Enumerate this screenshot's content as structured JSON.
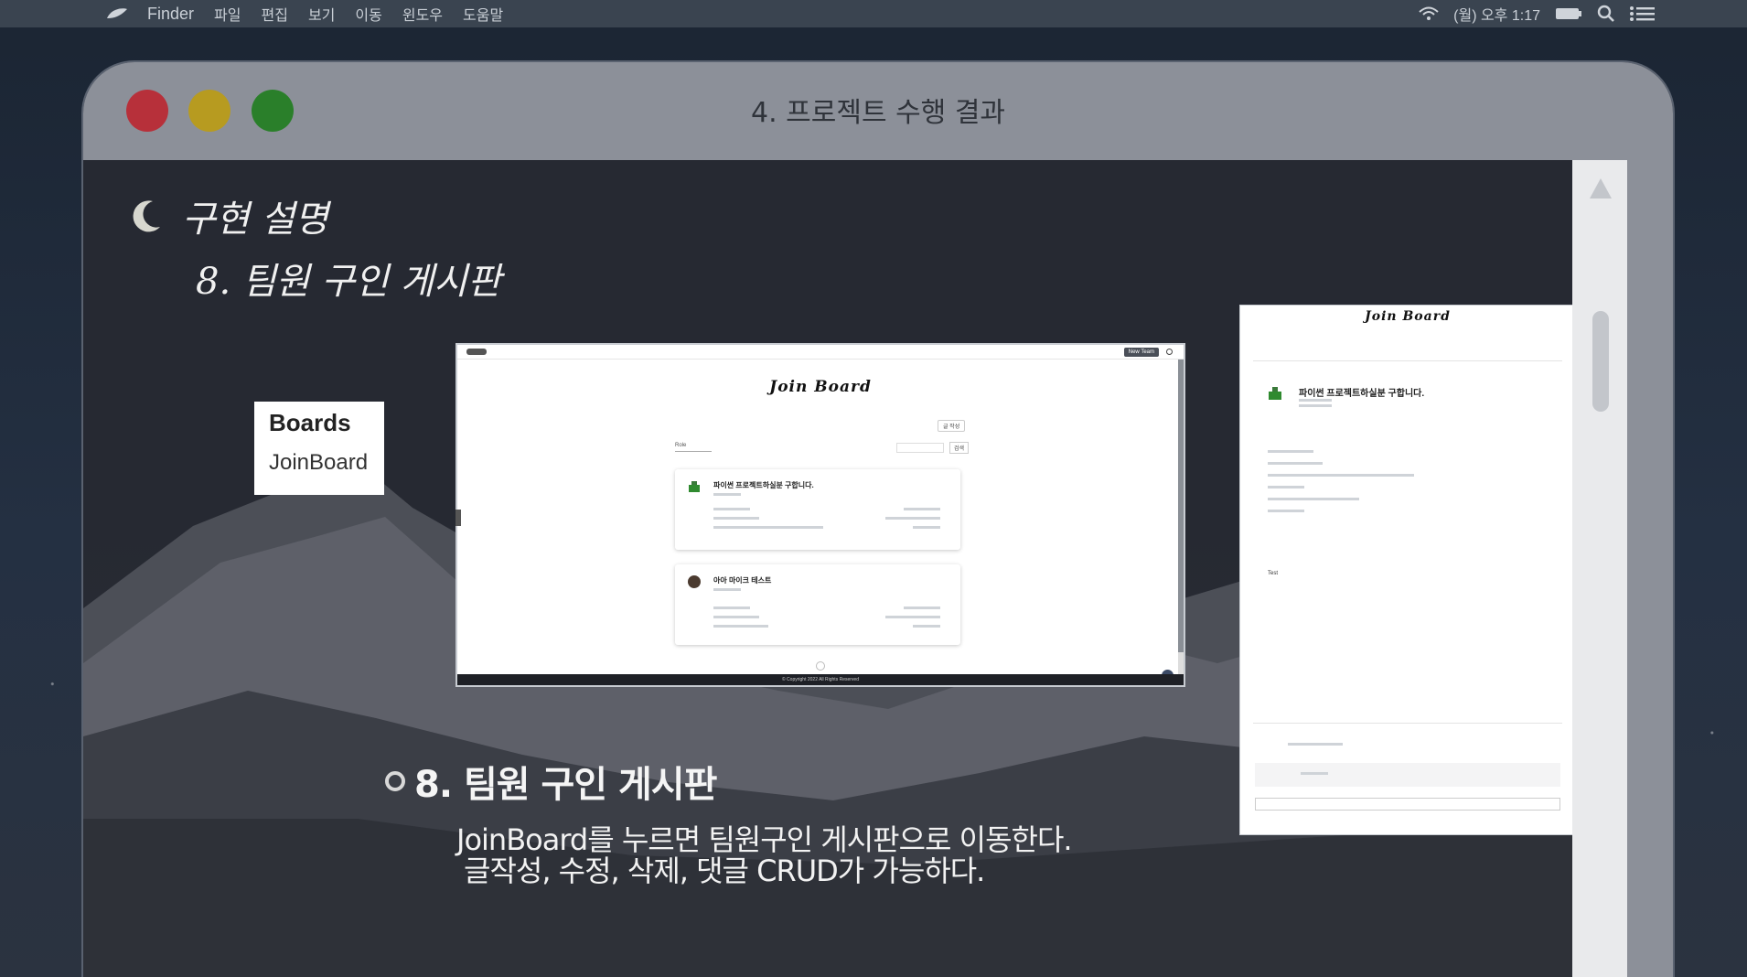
{
  "menubar": {
    "app_name": "Finder",
    "items": [
      "파일",
      "편집",
      "보기",
      "이동",
      "윈도우",
      "도움말"
    ],
    "clock": "(월) 오후 1:17"
  },
  "window": {
    "title": "4. 프로젝트 수행 결과"
  },
  "slide": {
    "heading": "구현 설명",
    "subheading": "8. 팀원 구인 게시판",
    "caption_title": "8. 팀원 구인 게시판",
    "caption_lines": [
      "JoinBoard를 누르면 팀원구인 게시판으로 이동한다.",
      "글작성, 수정, 삭제, 댓글 CRUD가 가능하다."
    ]
  },
  "boards_card": {
    "title": "Boards",
    "link": "JoinBoard"
  },
  "screenshot_list": {
    "new_team_button": "New Team",
    "logo_text": "Join Board",
    "write_button": "글 작성",
    "search_button": "검색",
    "filter_value": "Role",
    "posts": [
      {
        "title": "파이썬 프로젝트하실분 구합니다."
      },
      {
        "title": "아아 마이크 테스트"
      }
    ],
    "footer": "© Copyright 2022 All Rights Reserved"
  },
  "screenshot_detail": {
    "logo_text": "Join Board",
    "post_title": "파이썬 프로젝트하실분 구합니다.",
    "body_text": "Test"
  },
  "colors": {
    "red": "#b7303a",
    "yellow": "#b79b20",
    "green": "#2a7f2a",
    "titlebar": "#8c9099"
  }
}
